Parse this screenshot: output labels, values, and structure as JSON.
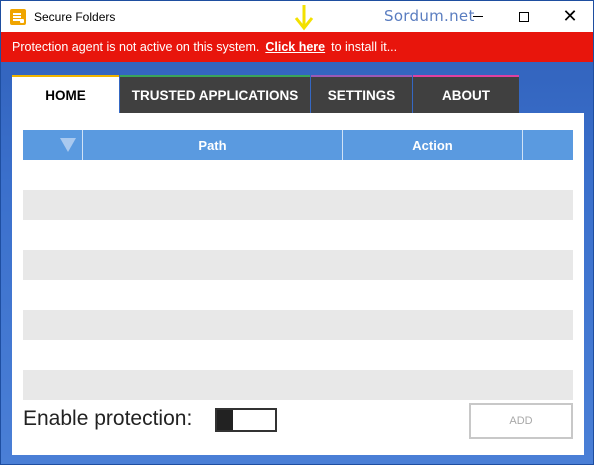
{
  "window": {
    "title": "Secure Folders",
    "watermark": "Sordum.net",
    "controls": {
      "minimize": "minimize",
      "maximize": "maximize",
      "close": "✕"
    }
  },
  "alert": {
    "message": "Protection agent is not active on this system.",
    "link": "Click here",
    "suffix": "to install it...",
    "color": "#e8150c"
  },
  "tabs": [
    {
      "label": "HOME",
      "active": true
    },
    {
      "label": "TRUSTED APPLICATIONS",
      "active": false
    },
    {
      "label": "SETTINGS",
      "active": false
    },
    {
      "label": "ABOUT",
      "active": false
    }
  ],
  "table": {
    "columns": [
      "",
      "Path",
      "Action",
      ""
    ],
    "rows": []
  },
  "footer": {
    "enable_label": "Enable protection:",
    "toggle_on": false,
    "add_label": "ADD"
  },
  "icons": {
    "app": "folder-lock-icon",
    "filter": "filter-icon",
    "annotation": "arrow-down-icon"
  }
}
